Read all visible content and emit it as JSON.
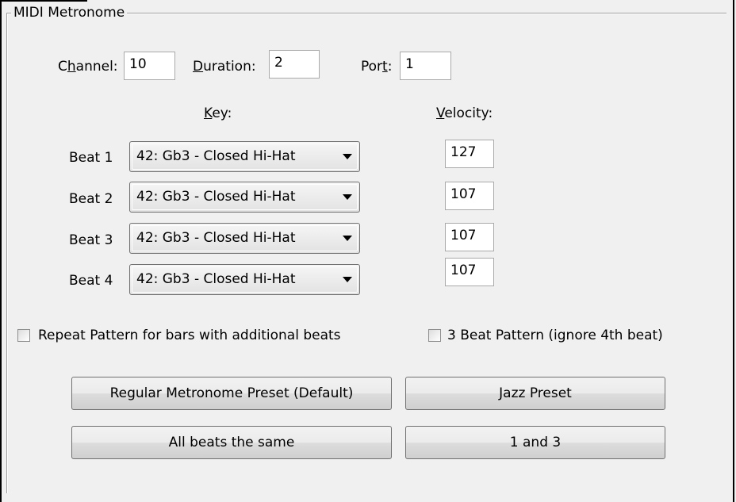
{
  "group": {
    "title": "MIDI Metronome"
  },
  "settings": {
    "channel_label_pre": "C",
    "channel_label_ul": "h",
    "channel_label_post": "annel:",
    "channel_value": "10",
    "duration_label_ul": "D",
    "duration_label_post": "uration:",
    "duration_value": "2",
    "port_label_pre": "Por",
    "port_label_ul": "t",
    "port_label_post": ":",
    "port_value": "1"
  },
  "headers": {
    "key_ul": "K",
    "key_post": "ey:",
    "velocity_ul": "V",
    "velocity_post": "elocity:"
  },
  "beats": [
    {
      "label": "Beat 1",
      "key": "42: Gb3  - Closed Hi-Hat",
      "velocity": "127"
    },
    {
      "label": "Beat 2",
      "key": "42: Gb3  - Closed Hi-Hat",
      "velocity": "107"
    },
    {
      "label": "Beat 3",
      "key": "42: Gb3  - Closed Hi-Hat",
      "velocity": "107"
    },
    {
      "label": "Beat 4",
      "key": "42: Gb3  - Closed Hi-Hat",
      "velocity": "107"
    }
  ],
  "options": {
    "repeat_pattern": {
      "label": "Repeat Pattern for bars with additional beats",
      "checked": false
    },
    "three_beat": {
      "label": "3 Beat Pattern (ignore 4th beat)",
      "checked": false
    }
  },
  "buttons": {
    "regular_preset": "Regular Metronome Preset  (Default)",
    "jazz_preset": "Jazz Preset",
    "all_same": "All beats the same",
    "one_and_three": "1 and 3"
  }
}
